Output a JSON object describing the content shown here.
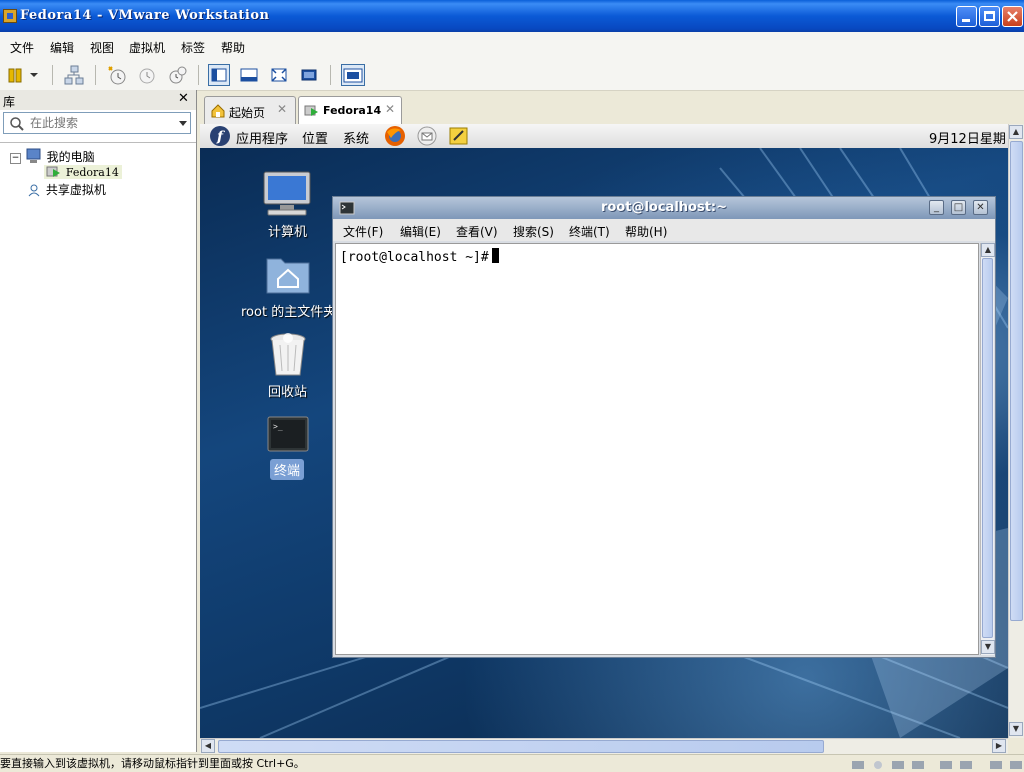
{
  "window": {
    "title": "Fedora14 - VMware Workstation"
  },
  "menubar": [
    "文件",
    "编辑",
    "视图",
    "虚拟机",
    "标签",
    "帮助"
  ],
  "library": {
    "title": "库",
    "search_placeholder": "在此搜索",
    "tree": {
      "my_computer": "我的电脑",
      "vm": "Fedora14",
      "shared": "共享虚拟机"
    }
  },
  "tabs": [
    {
      "label": "起始页"
    },
    {
      "label": "Fedora14"
    }
  ],
  "guest_panel": {
    "apps": "应用程序",
    "places": "位置",
    "system": "系统",
    "clock": "9月12日星期"
  },
  "desktop_icons": {
    "computer": "计算机",
    "home": "root 的主文件夹",
    "trash": "回收站",
    "terminal": "终端"
  },
  "terminal": {
    "title": "root@localhost:~",
    "menu": [
      "文件(F)",
      "编辑(E)",
      "查看(V)",
      "搜索(S)",
      "终端(T)",
      "帮助(H)"
    ],
    "prompt": "[root@localhost ~]#"
  },
  "statusbar": {
    "text": "要直接输入到该虚拟机，请移动鼠标指针到里面或按 Ctrl+G。"
  }
}
